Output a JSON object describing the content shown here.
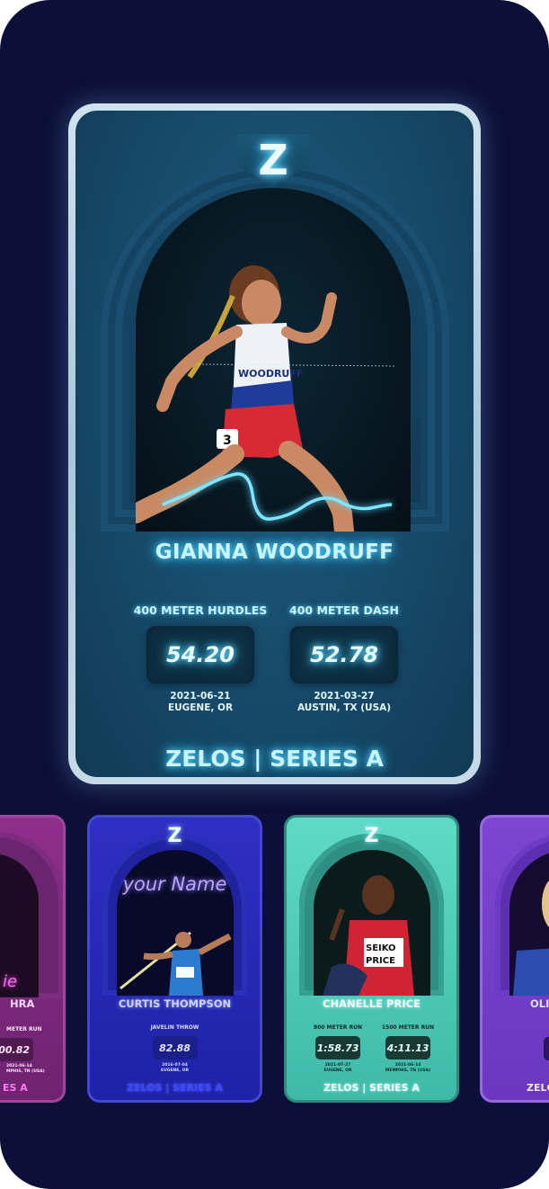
{
  "featured": {
    "logo": "Z",
    "athlete_name": "GIANNA WOODRUFF",
    "stats": [
      {
        "event": "400 METER HURDLES",
        "time": "54.20",
        "date": "2021-06-21",
        "location": "EUGENE, OR"
      },
      {
        "event": "400 METER DASH",
        "time": "52.78",
        "date": "2021-03-27",
        "location": "AUSTIN, TX (USA)"
      }
    ],
    "series": "ZELOS | SERIES A",
    "colors": {
      "accent": "#54d6ff",
      "card": "#174a6a",
      "frame": "#cfe3ef"
    }
  },
  "carousel": [
    {
      "partial": "left",
      "name_fragment": "HRA",
      "event_fragment": "METER RUN",
      "time_fragment": "00.82",
      "date_fragment": "2021-06-14",
      "location_fragment": "MPHIS, TN (USA)",
      "series_fragment": "ES A",
      "signature_fragment": "ie",
      "color": "#8b2e86"
    },
    {
      "logo": "Z",
      "signature": "your Name",
      "name": "CURTIS THOMPSON",
      "stats": [
        {
          "event": "JAVELIN THROW",
          "value": "82.88",
          "date": "2016-07-04",
          "location": "EUGENE, OR"
        }
      ],
      "series": "ZELOS | SERIES A",
      "color": "#2d2fb8"
    },
    {
      "logo": "Z",
      "name": "CHANELLE PRICE",
      "stats": [
        {
          "event": "800 METER RUN",
          "value": "1:58.73",
          "date": "2021-07-27",
          "location": "EUGENE, OR"
        },
        {
          "event": "1500 METER RUN",
          "value": "4:11.13",
          "date": "2021-06-14",
          "location": "MEMPHIS, TN (USA)"
        }
      ],
      "series": "ZELOS | SERIES A",
      "color": "#4fd3c1"
    },
    {
      "partial": "right",
      "name_fragment": "OLIV",
      "series_fragment": "ZELC",
      "color": "#7b45cf"
    }
  ]
}
